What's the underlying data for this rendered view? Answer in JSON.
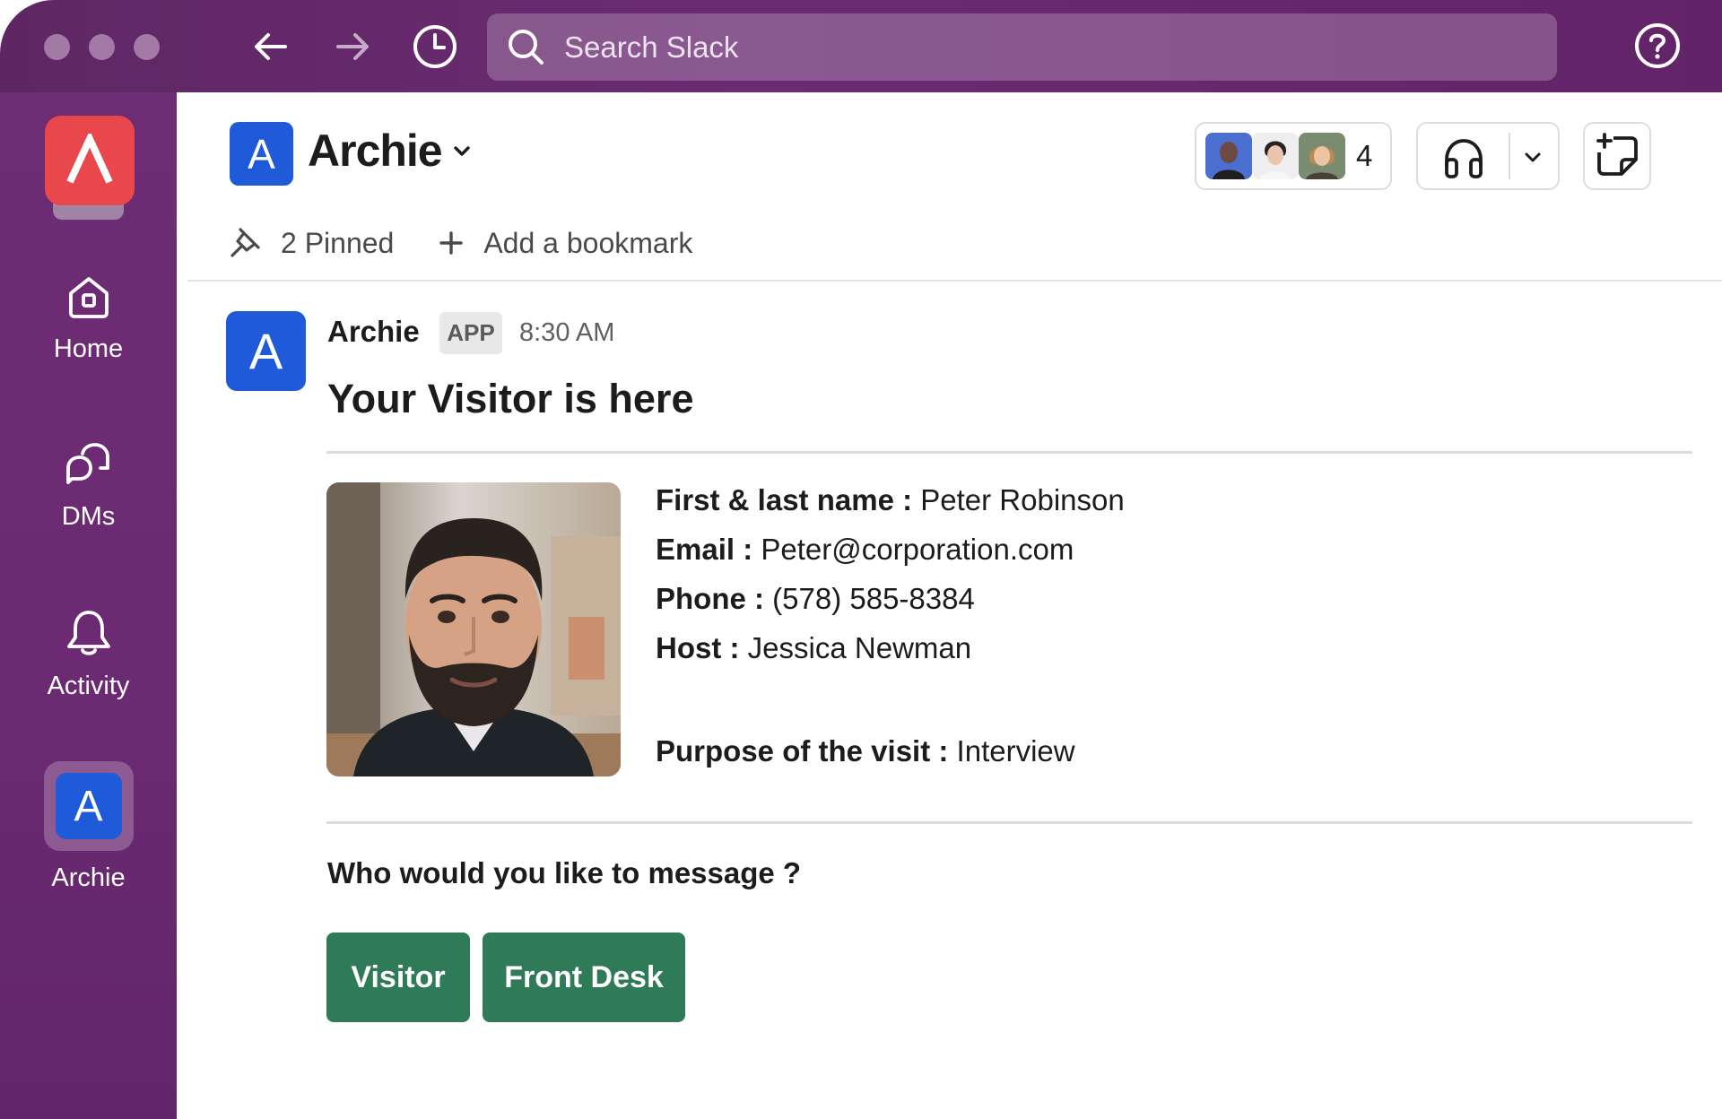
{
  "window": {
    "traffic_lights": [
      "close",
      "minimize",
      "zoom"
    ]
  },
  "topbar": {
    "back_icon": "arrow-left-icon",
    "forward_icon": "arrow-right-icon",
    "history_icon": "clock-icon",
    "search": {
      "placeholder": "Search Slack",
      "icon": "search-icon"
    },
    "help_icon": "help-circle-icon"
  },
  "sidebar": {
    "workspace_logo": "workspace-logo",
    "items": [
      {
        "label": "Home",
        "icon": "home-icon"
      },
      {
        "label": "DMs",
        "icon": "dms-icon"
      },
      {
        "label": "Activity",
        "icon": "bell-icon"
      },
      {
        "label": "Archie",
        "icon": "A",
        "active": true
      }
    ]
  },
  "channel": {
    "avatar_letter": "A",
    "name": "Archie",
    "member_count": "4",
    "bookmarks": [
      {
        "label": "2 Pinned",
        "icon": "pin-icon"
      },
      {
        "label": "Add a bookmark",
        "icon": "plus-icon"
      }
    ]
  },
  "message": {
    "avatar_letter": "A",
    "sender": "Archie",
    "badge": "APP",
    "time": "8:30 AM",
    "title": "Your Visitor is here",
    "fields": [
      {
        "label": "First & last name :",
        "value": "Peter Robinson"
      },
      {
        "label": "Email :",
        "value": "Peter@corporation.com"
      },
      {
        "label": "Phone :",
        "value": "(578) 585-8384"
      },
      {
        "label": "Host :",
        "value": "Jessica Newman"
      },
      {
        "label": "Purpose of the visit :",
        "value": "Interview"
      }
    ],
    "question": "Who would you like to message ?",
    "buttons": [
      {
        "label": "Visitor"
      },
      {
        "label": "Front Desk"
      }
    ]
  },
  "colors": {
    "topbar": "#5e2763",
    "sidebar": "#6d2c73",
    "workspace_logo": "#e8474b",
    "app_avatar": "#1f5bd8",
    "action_button": "#2f7a57"
  }
}
